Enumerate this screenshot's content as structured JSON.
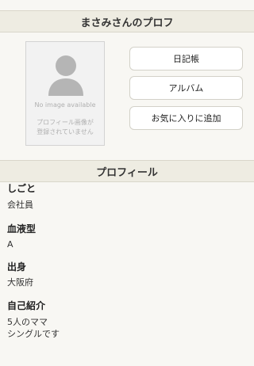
{
  "header": {
    "title": "まさみさんのプロフ"
  },
  "photo": {
    "no_image_label": "No image available",
    "note_line1": "プロフィール画像が",
    "note_line2": "登録されていません"
  },
  "actions": {
    "diary_label": "日記帳",
    "album_label": "アルバム",
    "favorite_label": "お気に入りに追加"
  },
  "profile": {
    "section_title": "プロフィール",
    "fields": [
      {
        "label": "しごと",
        "value": [
          "会社員"
        ]
      },
      {
        "label": "血液型",
        "value": [
          "A"
        ]
      },
      {
        "label": "出身",
        "value": [
          "大阪府"
        ]
      },
      {
        "label": "自己紹介",
        "value": [
          "5人のママ",
          "シングルです"
        ]
      }
    ]
  },
  "colors": {
    "page_background": "#f8f7f3",
    "header_background": "#eeece2",
    "button_background": "#ffffff",
    "avatar_gray": "#b5b5b5"
  },
  "icons": {
    "avatar": "person-silhouette-icon"
  }
}
